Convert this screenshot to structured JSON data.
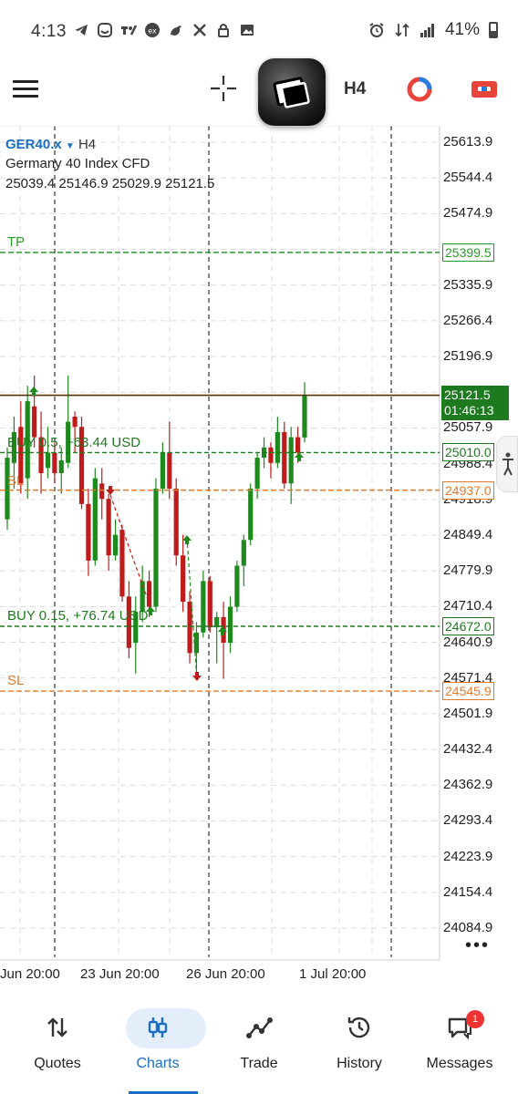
{
  "status_bar": {
    "time": "4:13",
    "battery": "41%"
  },
  "toolbar": {
    "timeframe": "H4"
  },
  "chart_header": {
    "symbol": "GER40.x",
    "timeframe": "H4",
    "description": "Germany 40 Index CFD",
    "ohlc": "25039.4 25146.9 25029.9 25121.5"
  },
  "levels": {
    "tp_label": "TP",
    "tp_price": "25399.5",
    "sl1_label": "SL",
    "sl1_price": "24937.0",
    "sl2_label": "SL",
    "sl2_price": "24545.9",
    "buy1_label": "BUY 0.5,  +63.44 USD",
    "buy1_price": "25010.0",
    "buy2_label": "BUY 0.15,  +76.74 USD",
    "buy2_price": "24672.0",
    "current_price": "25121.5",
    "countdown": "01:46:13"
  },
  "price_axis": [
    "25613.9",
    "25544.4",
    "25474.9",
    "25335.9",
    "25266.4",
    "25196.9",
    "25057.9",
    "24988.4",
    "24918.9",
    "24849.4",
    "24779.9",
    "24710.4",
    "24640.9",
    "24571.4",
    "24501.9",
    "24432.4",
    "24362.9",
    "24293.4",
    "24223.9",
    "24154.4",
    "24084.9"
  ],
  "time_axis": [
    "Jun 20:00",
    "23 Jun 20:00",
    "26 Jun 20:00",
    "1 Jul 20:00"
  ],
  "colors": {
    "up": "#1e8a1e",
    "down": "#c01b1b",
    "tp": "#2a9a2a",
    "sl": "#e07b2c",
    "buy": "#1e7a1e",
    "price_line": "#5a3300",
    "current_bg": "#1e7a1e",
    "accent": "#1a6fc4"
  },
  "nav": {
    "quotes": "Quotes",
    "charts": "Charts",
    "trade": "Trade",
    "history": "History",
    "messages": "Messages",
    "messages_badge": "1"
  },
  "chart_data": {
    "type": "candlestick",
    "symbol": "GER40.x",
    "ylim": [
      24050,
      25650
    ],
    "candles": [
      {
        "o": 24880,
        "h": 25020,
        "l": 24860,
        "c": 25000
      },
      {
        "o": 24990,
        "h": 25080,
        "l": 24940,
        "c": 25050
      },
      {
        "o": 25060,
        "h": 25110,
        "l": 24930,
        "c": 24950
      },
      {
        "o": 24960,
        "h": 25140,
        "l": 24920,
        "c": 25110
      },
      {
        "o": 25100,
        "h": 25160,
        "l": 25020,
        "c": 25040
      },
      {
        "o": 25040,
        "h": 25090,
        "l": 24930,
        "c": 24970
      },
      {
        "o": 24980,
        "h": 25060,
        "l": 24960,
        "c": 25010
      },
      {
        "o": 25010,
        "h": 25030,
        "l": 24950,
        "c": 24970
      },
      {
        "o": 24970,
        "h": 25020,
        "l": 24930,
        "c": 24995
      },
      {
        "o": 24990,
        "h": 25160,
        "l": 24980,
        "c": 25070
      },
      {
        "o": 25080,
        "h": 25090,
        "l": 25010,
        "c": 25060
      },
      {
        "o": 25060,
        "h": 25080,
        "l": 24900,
        "c": 24910
      },
      {
        "o": 24910,
        "h": 24940,
        "l": 24770,
        "c": 24800
      },
      {
        "o": 24800,
        "h": 24980,
        "l": 24790,
        "c": 24960
      },
      {
        "o": 24950,
        "h": 24980,
        "l": 24880,
        "c": 24920
      },
      {
        "o": 24920,
        "h": 24930,
        "l": 24780,
        "c": 24810
      },
      {
        "o": 24810,
        "h": 24880,
        "l": 24800,
        "c": 24850
      },
      {
        "o": 24860,
        "h": 24870,
        "l": 24720,
        "c": 24730
      },
      {
        "o": 24730,
        "h": 24760,
        "l": 24610,
        "c": 24630
      },
      {
        "o": 24640,
        "h": 24730,
        "l": 24580,
        "c": 24700
      },
      {
        "o": 24700,
        "h": 24790,
        "l": 24680,
        "c": 24760
      },
      {
        "o": 24760,
        "h": 24780,
        "l": 24690,
        "c": 24710
      },
      {
        "o": 24710,
        "h": 24960,
        "l": 24700,
        "c": 24940
      },
      {
        "o": 24940,
        "h": 25030,
        "l": 24930,
        "c": 25010
      },
      {
        "o": 25010,
        "h": 25070,
        "l": 24920,
        "c": 24940
      },
      {
        "o": 24940,
        "h": 24960,
        "l": 24790,
        "c": 24810
      },
      {
        "o": 24810,
        "h": 24850,
        "l": 24700,
        "c": 24720
      },
      {
        "o": 24720,
        "h": 24740,
        "l": 24600,
        "c": 24620
      },
      {
        "o": 24620,
        "h": 24680,
        "l": 24570,
        "c": 24660
      },
      {
        "o": 24660,
        "h": 24780,
        "l": 24650,
        "c": 24760
      },
      {
        "o": 24760,
        "h": 24770,
        "l": 24660,
        "c": 24670
      },
      {
        "o": 24670,
        "h": 24700,
        "l": 24600,
        "c": 24690
      },
      {
        "o": 24690,
        "h": 24720,
        "l": 24570,
        "c": 24640
      },
      {
        "o": 24640,
        "h": 24730,
        "l": 24620,
        "c": 24710
      },
      {
        "o": 24710,
        "h": 24800,
        "l": 24700,
        "c": 24790
      },
      {
        "o": 24790,
        "h": 24850,
        "l": 24750,
        "c": 24840
      },
      {
        "o": 24840,
        "h": 24950,
        "l": 24830,
        "c": 24940
      },
      {
        "o": 24940,
        "h": 25010,
        "l": 24920,
        "c": 25000
      },
      {
        "o": 25000,
        "h": 25040,
        "l": 24980,
        "c": 25020
      },
      {
        "o": 25020,
        "h": 25030,
        "l": 24960,
        "c": 24990
      },
      {
        "o": 24990,
        "h": 25080,
        "l": 24980,
        "c": 25050
      },
      {
        "o": 25050,
        "h": 25070,
        "l": 24940,
        "c": 24950
      },
      {
        "o": 24950,
        "h": 25060,
        "l": 24910,
        "c": 25040
      },
      {
        "o": 25040,
        "h": 25060,
        "l": 24990,
        "c": 25010
      },
      {
        "o": 25039.4,
        "h": 25146.9,
        "l": 25029.9,
        "c": 25121.5
      }
    ]
  }
}
